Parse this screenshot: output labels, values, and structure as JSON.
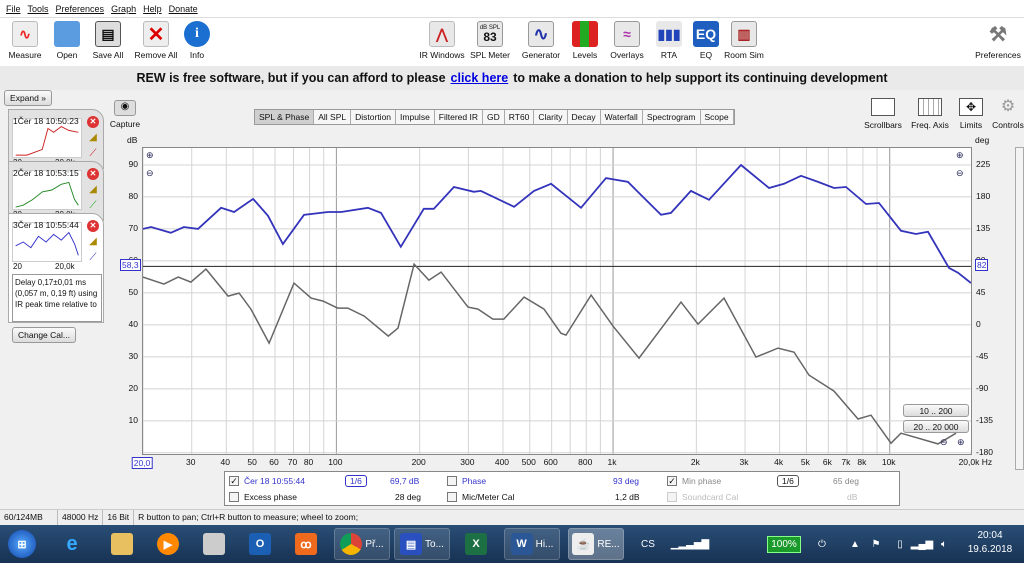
{
  "menu": [
    "File",
    "Tools",
    "Preferences",
    "Graph",
    "Help",
    "Donate"
  ],
  "toolbar": {
    "left": [
      {
        "label": "Measure",
        "icon": "measure-icon"
      },
      {
        "label": "Open",
        "icon": "folder-icon"
      },
      {
        "label": "Save All",
        "icon": "save-all-icon"
      },
      {
        "label": "Remove All",
        "icon": "remove-all-icon"
      },
      {
        "label": "Info",
        "icon": "info-icon"
      }
    ],
    "center": [
      {
        "label": "IR Windows",
        "icon": "ir-windows-icon"
      },
      {
        "label": "SPL Meter",
        "icon": "spl-meter-icon",
        "badge_top": "dB SPL",
        "badge_value": "83"
      },
      {
        "label": "Generator",
        "icon": "generator-icon"
      },
      {
        "label": "Levels",
        "icon": "levels-icon"
      },
      {
        "label": "Overlays",
        "icon": "overlays-icon"
      },
      {
        "label": "RTA",
        "icon": "rta-icon"
      },
      {
        "label": "EQ",
        "icon": "eq-icon"
      },
      {
        "label": "Room Sim",
        "icon": "room-sim-icon"
      }
    ],
    "right": {
      "label": "Preferences",
      "icon": "wrench-icon"
    }
  },
  "banner": {
    "text_before": "REW is free software, but if you can afford to please",
    "link": "click here",
    "text_after": "to make a donation to help support its continuing development"
  },
  "left_panel": {
    "expand": "Expand",
    "measurements": [
      {
        "index": "1",
        "name": "Čer 18 10:50:23",
        "x_start": "20",
        "x_end": "20,0k",
        "color": "#cc2222"
      },
      {
        "index": "2",
        "name": "Čer 18 10:53:15",
        "x_start": "20",
        "x_end": "20,0k",
        "color": "#228822"
      },
      {
        "index": "3",
        "name": "Čer 18 10:55:44",
        "x_start": "20",
        "x_end": "20,0k",
        "color": "#3333cc"
      }
    ],
    "info_text": "Delay 0,17±0,01 ms (0,057 m, 0,19 ft) using IR peak time relative to",
    "change_cal": "Change Cal..."
  },
  "capture": "Capture",
  "graph_tabs": [
    {
      "label": "SPL & Phase",
      "active": true
    },
    {
      "label": "All SPL"
    },
    {
      "label": "Distortion"
    },
    {
      "label": "Impulse"
    },
    {
      "label": "Filtered IR"
    },
    {
      "label": "GD"
    },
    {
      "label": "RT60"
    },
    {
      "label": "Clarity"
    },
    {
      "label": "Decay"
    },
    {
      "label": "Waterfall"
    },
    {
      "label": "Spectrogram"
    },
    {
      "label": "Scope"
    }
  ],
  "graph_tools": [
    {
      "label": "Scrollbars"
    },
    {
      "label": "Freq. Axis"
    },
    {
      "label": "Limits"
    },
    {
      "label": "Controls"
    }
  ],
  "range_buttons": [
    "10 .. 200",
    "20 .. 20 000"
  ],
  "cursor": {
    "left_value": "58,3",
    "right_value": "82"
  },
  "chart_data": {
    "type": "line",
    "xscale": "log",
    "xlim": [
      20,
      20000
    ],
    "xunit": "Hz",
    "ylabel_left": "dB",
    "ylabel_right": "deg",
    "ylim_left": [
      -1,
      95.3
    ],
    "ylim_right": [
      -184,
      249
    ],
    "grid": true,
    "x_ticks": [
      {
        "v": 20,
        "l": "20,0"
      },
      {
        "v": 30,
        "l": "30"
      },
      {
        "v": 40,
        "l": "40"
      },
      {
        "v": 50,
        "l": "50"
      },
      {
        "v": 60,
        "l": "60"
      },
      {
        "v": 70,
        "l": "70"
      },
      {
        "v": 80,
        "l": "80"
      },
      {
        "v": 100,
        "l": "100"
      },
      {
        "v": 200,
        "l": "200"
      },
      {
        "v": 300,
        "l": "300"
      },
      {
        "v": 400,
        "l": "400"
      },
      {
        "v": 500,
        "l": "500"
      },
      {
        "v": 600,
        "l": "600"
      },
      {
        "v": 800,
        "l": "800"
      },
      {
        "v": 1000,
        "l": "1k"
      },
      {
        "v": 2000,
        "l": "2k"
      },
      {
        "v": 3000,
        "l": "3k"
      },
      {
        "v": 4000,
        "l": "4k"
      },
      {
        "v": 5000,
        "l": "5k"
      },
      {
        "v": 6000,
        "l": "6k"
      },
      {
        "v": 7000,
        "l": "7k"
      },
      {
        "v": 8000,
        "l": "8k"
      },
      {
        "v": 10000,
        "l": "10k"
      },
      {
        "v": 20000,
        "l": "20,0k Hz"
      }
    ],
    "y_ticks_left": [
      10,
      20,
      30,
      40,
      50,
      60,
      70,
      80,
      90
    ],
    "y_ticks_right": [
      225,
      180,
      135,
      90,
      45,
      0,
      -45,
      -90,
      -135,
      -180
    ],
    "series": [
      {
        "name": "Čer 18 10:55:44",
        "axis": "left",
        "color": "#3333bb",
        "points": [
          [
            20,
            70.0
          ],
          [
            21.4,
            70.6
          ],
          [
            25.2,
            68.8
          ],
          [
            28.1,
            70.6
          ],
          [
            31.6,
            70.0
          ],
          [
            38.3,
            76.6
          ],
          [
            42.7,
            75.3
          ],
          [
            50,
            79.4
          ],
          [
            56.6,
            74.1
          ],
          [
            64.1,
            65.3
          ],
          [
            76.4,
            74.4
          ],
          [
            93.3,
            75.3
          ],
          [
            104,
            75.3
          ],
          [
            130,
            76.6
          ],
          [
            145,
            75.0
          ],
          [
            171,
            64.4
          ],
          [
            207,
            76.3
          ],
          [
            225,
            76.3
          ],
          [
            266,
            83.1
          ],
          [
            314,
            81.6
          ],
          [
            333,
            81.9
          ],
          [
            439,
            76.9
          ],
          [
            518,
            81.9
          ],
          [
            597,
            84.1
          ],
          [
            766,
            76.6
          ],
          [
            943,
            85.9
          ],
          [
            1132,
            84.7
          ],
          [
            1491,
            74.4
          ],
          [
            1620,
            75.0
          ],
          [
            1912,
            81.9
          ],
          [
            2222,
            79.1
          ],
          [
            2900,
            90.0
          ],
          [
            3662,
            82.8
          ],
          [
            4150,
            84.1
          ],
          [
            4778,
            86.6
          ],
          [
            5508,
            84.7
          ],
          [
            6292,
            82.8
          ],
          [
            6950,
            83.1
          ],
          [
            8212,
            77.8
          ],
          [
            9150,
            78.1
          ],
          [
            10988,
            69.4
          ],
          [
            12446,
            68.4
          ],
          [
            13756,
            69.1
          ],
          [
            16382,
            57.8
          ],
          [
            17656,
            56.3
          ],
          [
            19670,
            53.1
          ]
        ]
      },
      {
        "name": "Phase",
        "axis": "right",
        "color": "#666666",
        "points": [
          [
            20,
            67.5
          ],
          [
            23.8,
            57.7
          ],
          [
            26.8,
            67.5
          ],
          [
            29.8,
            60.5
          ],
          [
            33.8,
            78.8
          ],
          [
            40.6,
            40.8
          ],
          [
            44.5,
            45
          ],
          [
            49.1,
            22.5
          ],
          [
            57.1,
            -25.3
          ],
          [
            70.3,
            59.1
          ],
          [
            81,
            38
          ],
          [
            89.5,
            33.8
          ],
          [
            101,
            23.9
          ],
          [
            110,
            23.9
          ],
          [
            126,
            12.7
          ],
          [
            154,
            -15.5
          ],
          [
            167,
            -4.2
          ],
          [
            191,
            85.8
          ],
          [
            216,
            63.3
          ],
          [
            239,
            74.5
          ],
          [
            299,
            25.3
          ],
          [
            325,
            22.5
          ],
          [
            368,
            8.4
          ],
          [
            403,
            8.4
          ],
          [
            477,
            39.4
          ],
          [
            563,
            22.5
          ],
          [
            648,
            -11.3
          ],
          [
            676,
            -14.1
          ],
          [
            833,
            42.2
          ],
          [
            1000,
            -1.4
          ],
          [
            1241,
            -46.4
          ],
          [
            1761,
            32.3
          ],
          [
            2028,
            1.4
          ],
          [
            2518,
            38
          ],
          [
            3286,
            -45
          ],
          [
            3946,
            -32.3
          ],
          [
            4508,
            -38
          ],
          [
            5110,
            -70.3
          ],
          [
            6292,
            -92.8
          ],
          [
            7682,
            -132
          ],
          [
            8558,
            -126.6
          ],
          [
            10106,
            -166
          ],
          [
            10988,
            -151.9
          ],
          [
            14944,
            -167
          ],
          [
            17366,
            -152
          ]
        ]
      }
    ]
  },
  "legend": {
    "row1": {
      "name": "Čer 18 10:55:44",
      "checked": true,
      "smoothing": "1/6",
      "value": "69,7 dB",
      "phase_label": "Phase",
      "phase_checked": false,
      "phase_value": "93 deg",
      "min_phase_label": "Min phase",
      "min_phase_checked": true,
      "min_smoothing": "1/6",
      "min_value": "65 deg"
    },
    "row2": {
      "excess_label": "Excess phase",
      "excess_value": "28 deg",
      "mic_label": "Mic/Meter Cal",
      "mic_value": "1,2 dB",
      "sc_label": "Soundcard Cal",
      "sc_value": "dB"
    }
  },
  "status": {
    "memory": "60/124MB",
    "rate": "48000 Hz",
    "bits": "16 Bit",
    "hint": "R button to pan; Ctrl+R button to measure; wheel to zoom;"
  },
  "taskbar": {
    "chrome": "Př...",
    "floppy": "To...",
    "word": "Hi...",
    "rew": "RE...",
    "lang": "CS",
    "battery": "100%",
    "time": "20:04",
    "date": "19.6.2018"
  }
}
